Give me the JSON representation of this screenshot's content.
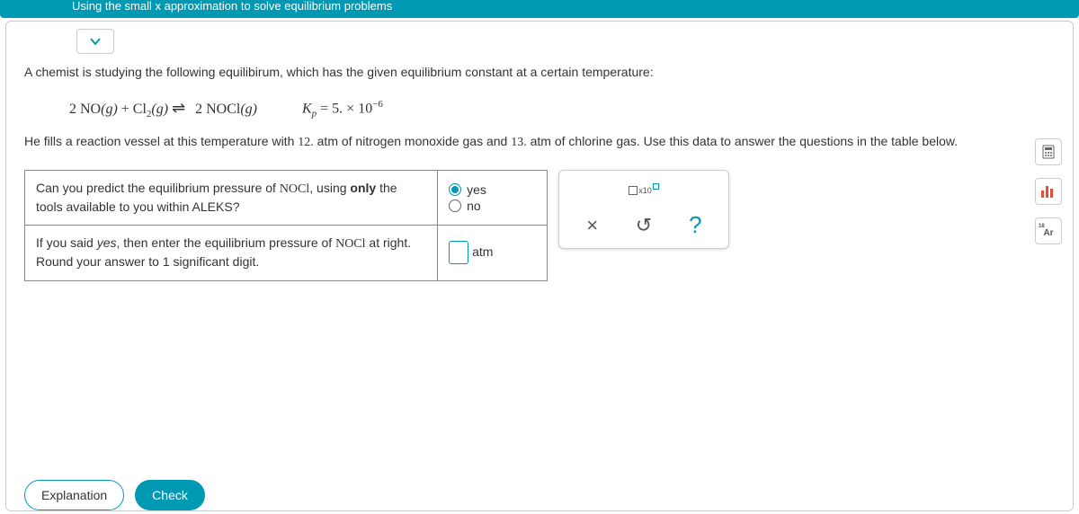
{
  "header": {
    "title": "Using the small x approximation to solve equilibrium problems"
  },
  "problem": {
    "intro": "A chemist is studying the following equilibirum, which has the given equilibrium constant at a certain temperature:",
    "equation": {
      "left1": "2 NO",
      "state1": "(g)",
      "plus": " + ",
      "left2": "Cl",
      "sub2": "2",
      "state2": "(g)",
      "right": "2 NOCl",
      "state3": "(g)"
    },
    "kp": {
      "label": "K",
      "sub": "p",
      "eq": " = 5. × 10",
      "exp": "−6"
    },
    "desc_a": "He fills a reaction vessel at this temperature with ",
    "val1": "12.",
    "desc_b": " atm of nitrogen monoxide gas and ",
    "val2": "13.",
    "desc_c": " atm of chlorine gas. Use this data to answer the questions in the table below."
  },
  "questions": {
    "q1_a": "Can you predict the equilibrium pressure of ",
    "q1_chem": "NOCl",
    "q1_b": ", using ",
    "q1_bold": "only",
    "q1_c": " the tools available to you within ALEKS?",
    "yes": "yes",
    "no": "no",
    "q2_a": "If you said ",
    "q2_ital": "yes",
    "q2_b": ", then enter the equilibrium pressure of ",
    "q2_chem": "NOCl",
    "q2_c": " at right. Round your answer to 1 significant digit.",
    "unit": "atm"
  },
  "tools": {
    "sci_sub": "x10",
    "clear": "×",
    "reset": "↺",
    "help": "?"
  },
  "side": {
    "calc": "calc",
    "scale": "scale",
    "periodic": "Ar"
  },
  "footer": {
    "explain": "Explanation",
    "check": "Check"
  }
}
